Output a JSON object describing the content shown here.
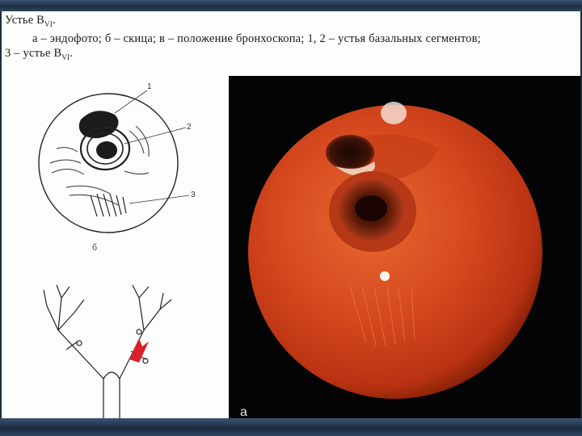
{
  "caption": {
    "title": "Устье В",
    "title_sub": "VI",
    "line2": "а – эндофото; б – скица; в – положение бронхоскопа; 1, 2 – устья базальных сегментов;",
    "line3": "3 – устье В",
    "line3_sub": "VI"
  },
  "sketch": {
    "label": "б",
    "callouts": [
      "1",
      "2",
      "3"
    ]
  },
  "photo": {
    "label": "а"
  },
  "colors": {
    "frame": "#1c2c40",
    "page": "#fdfdfb",
    "mucosa": "#d4471e",
    "arrow": "#d8202a"
  }
}
